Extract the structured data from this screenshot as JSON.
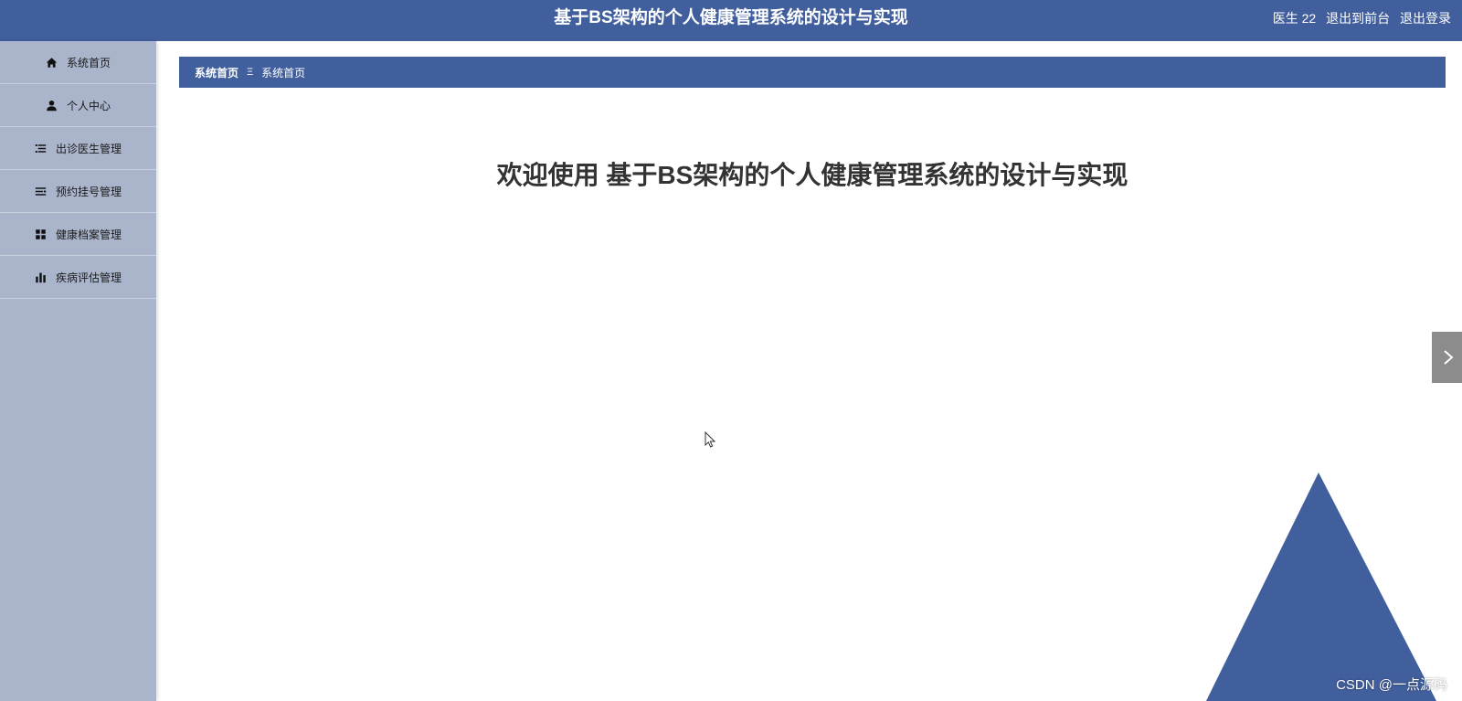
{
  "header": {
    "title": "基于BS架构的个人健康管理系统的设计与实现",
    "user": "医生 22",
    "front_link": "退出到前台",
    "logout_link": "退出登录"
  },
  "sidebar": {
    "items": [
      {
        "label": "系统首页",
        "icon": "home-icon"
      },
      {
        "label": "个人中心",
        "icon": "user-icon"
      },
      {
        "label": "出诊医生管理",
        "icon": "list-icon"
      },
      {
        "label": "预约挂号管理",
        "icon": "list-icon"
      },
      {
        "label": "健康档案管理",
        "icon": "grid-icon"
      },
      {
        "label": "疾病评估管理",
        "icon": "bar-chart-icon"
      }
    ]
  },
  "breadcrumb": {
    "home": "系统首页",
    "separator": "Ξ",
    "current": "系统首页"
  },
  "main": {
    "welcome": "欢迎使用 基于BS架构的个人健康管理系统的设计与实现"
  },
  "watermark": "CSDN @一点源码",
  "colors": {
    "primary": "#415f9d",
    "sidebar_bg": "#aab5cb",
    "toggle_bg": "#8c8c8c"
  }
}
